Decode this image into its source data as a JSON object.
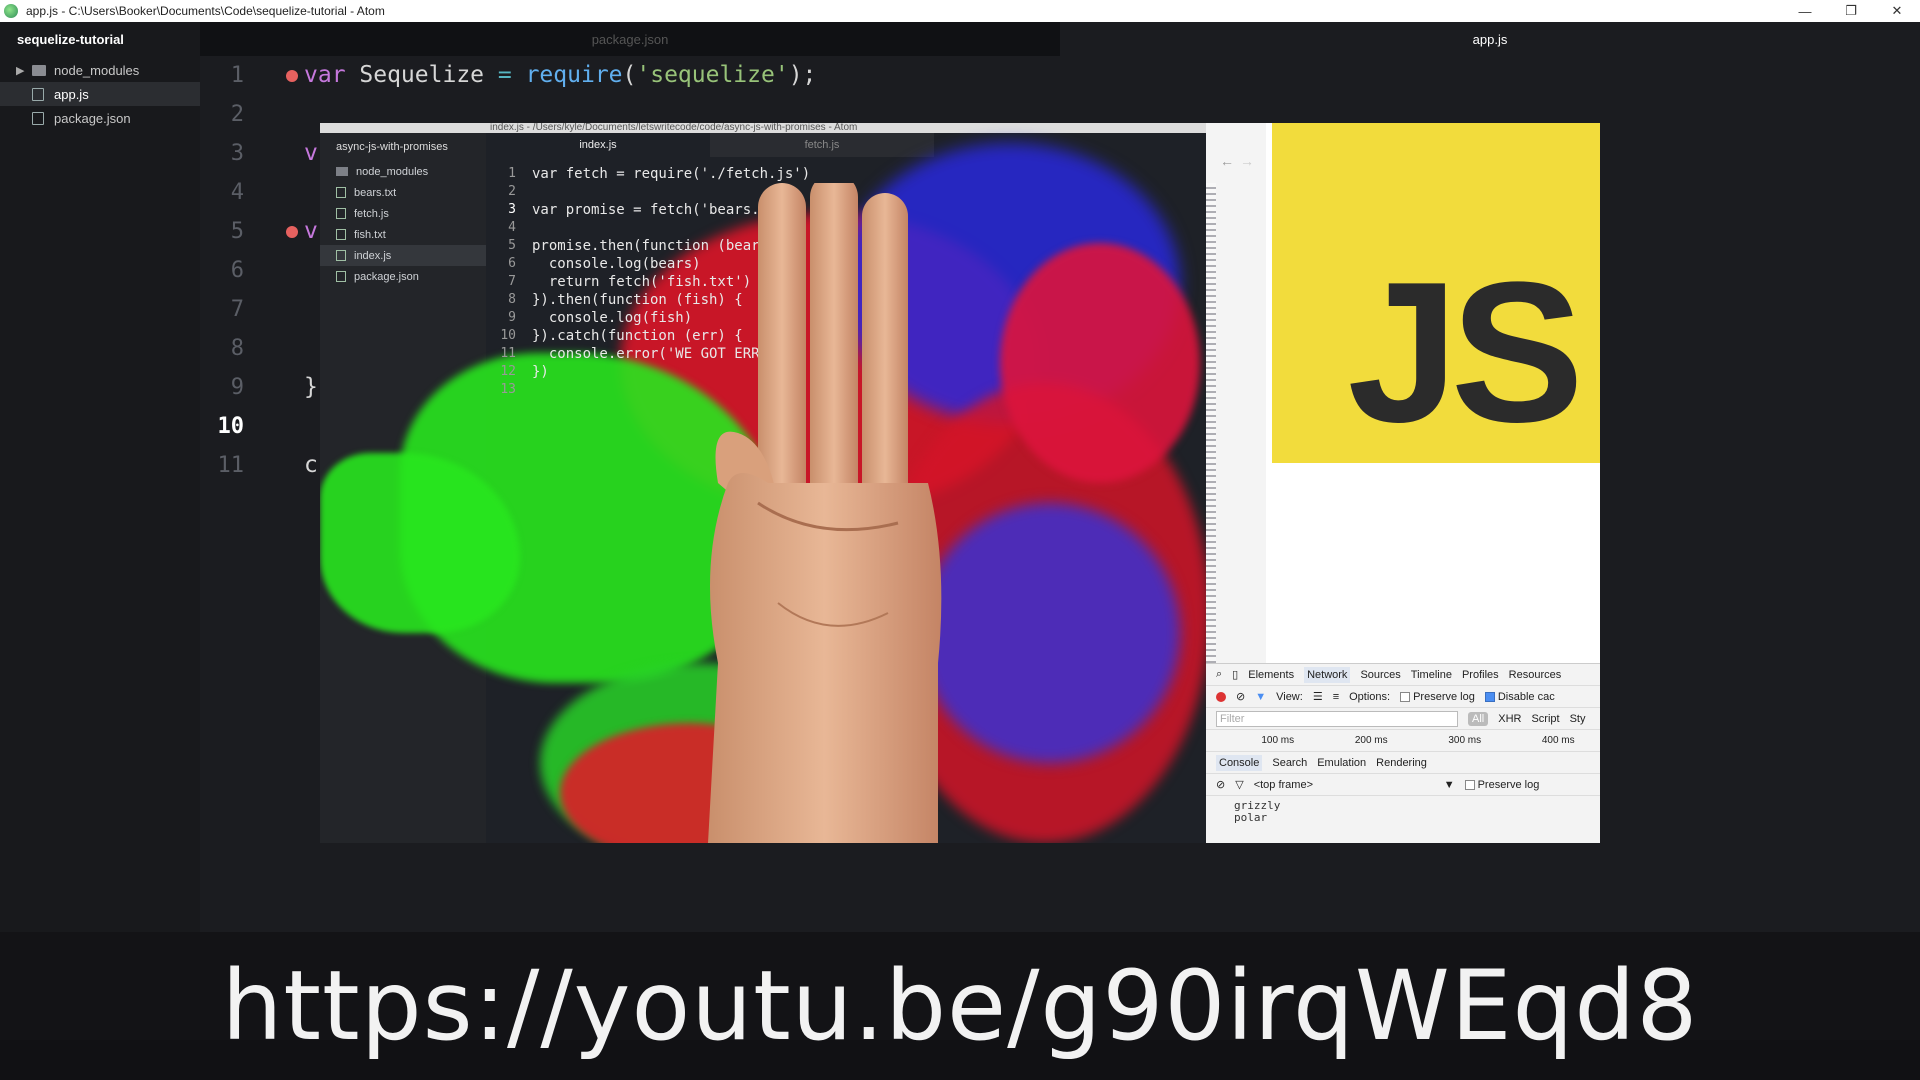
{
  "window": {
    "title": "app.js - C:\\Users\\Booker\\Documents\\Code\\sequelize-tutorial - Atom",
    "minimize": "—",
    "restore": "❐",
    "close": "✕"
  },
  "sidebar": {
    "project": "sequelize-tutorial",
    "items": [
      {
        "label": "node_modules",
        "type": "folder"
      },
      {
        "label": "app.js",
        "type": "file"
      },
      {
        "label": "package.json",
        "type": "file"
      }
    ]
  },
  "tabs": [
    {
      "label": "package.json",
      "active": false
    },
    {
      "label": "app.js",
      "active": true
    }
  ],
  "editor": {
    "line_numbers": [
      "1",
      "2",
      "3",
      "4",
      "5",
      "6",
      "7",
      "8",
      "9",
      "10",
      "11"
    ],
    "current_line": "10",
    "line1": {
      "kw": "var",
      "name": " Sequelize ",
      "op": "=",
      "fn": " require",
      "open": "(",
      "str": "'sequelize'",
      "close": ");"
    },
    "line3_fragment": "v",
    "line5_fragment": "v",
    "line8_fragment": "}",
    "line10_fragment": "c"
  },
  "video": {
    "atom_title": "index.js - /Users/kyle/Documents/letswritecode/code/async-js-with-promises - Atom",
    "tree_root": "async-js-with-promises",
    "tree": [
      "node_modules",
      "bears.txt",
      "fetch.js",
      "fish.txt",
      "index.js",
      "package.json"
    ],
    "tabs": [
      "index.js",
      "fetch.js"
    ],
    "code": [
      {
        "n": "1",
        "t": "var fetch = require('./fetch.js')"
      },
      {
        "n": "2",
        "t": ""
      },
      {
        "n": "3",
        "t": "var promise = fetch('bears.txt')"
      },
      {
        "n": "4",
        "t": ""
      },
      {
        "n": "5",
        "t": "promise.then(function (bears) {"
      },
      {
        "n": "6",
        "t": "  console.log(bears)"
      },
      {
        "n": "7",
        "t": "  return fetch('fish.txt')"
      },
      {
        "n": "8",
        "t": "}).then(function (fish) {"
      },
      {
        "n": "9",
        "t": "  console.log(fish)"
      },
      {
        "n": "10",
        "t": "}).catch(function (err) {"
      },
      {
        "n": "11",
        "t": "  console.error('WE GOT ERROR"
      },
      {
        "n": "12",
        "t": "})"
      },
      {
        "n": "13",
        "t": ""
      }
    ],
    "js_logo": "JS",
    "devtools": {
      "tabs": [
        "Elements",
        "Network",
        "Sources",
        "Timeline",
        "Profiles",
        "Resources"
      ],
      "active_tab": "Network",
      "view_label": "View:",
      "options_label": "Options:",
      "preserve_log": "Preserve log",
      "disable_cache": "Disable cac",
      "filter_placeholder": "Filter",
      "filter_types": [
        "All",
        "XHR",
        "Script",
        "Sty"
      ],
      "timeline_ticks": [
        "100 ms",
        "200 ms",
        "300 ms",
        "400 ms"
      ],
      "drawer_tabs": [
        "Console",
        "Search",
        "Emulation",
        "Rendering"
      ],
      "frame": "<top frame>",
      "drawer_preserve": "Preserve log",
      "console_lines": [
        "grizzly",
        "polar"
      ]
    }
  },
  "overlay": {
    "url": "https://youtu.be/g90irqWEqd8"
  },
  "colors": {
    "js_yellow": "#f2dc3c",
    "breakpoint": "#e6615f"
  }
}
